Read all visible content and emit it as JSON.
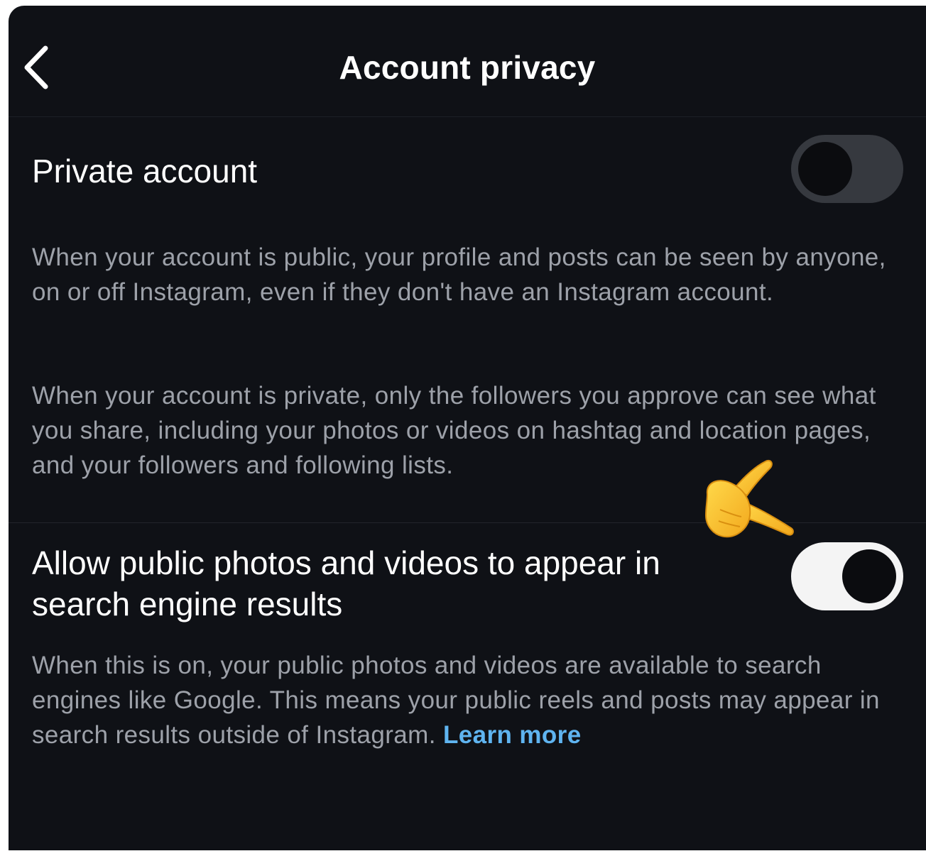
{
  "header": {
    "title": "Account privacy",
    "back_icon": "chevron-left-icon"
  },
  "private_account": {
    "label": "Private account",
    "toggle_on": false,
    "description_public": "When your account is public, your profile and posts can be seen by anyone, on or off Instagram, even if they don't have an Instagram account.",
    "description_private": "When your account is private, only the followers you approve can see what you share, including your photos or videos on hashtag and location pages, and your followers and following lists."
  },
  "search_engine": {
    "label": "Allow public photos and videos to appear in search engine results",
    "toggle_on": true,
    "description": "When this is on, your public photos and videos are available to search engines like Google. This means your public reels and posts may appear in search results outside of Instagram. ",
    "learn_more": "Learn more"
  },
  "decoration": {
    "pointing_hand_icon": "backhand-index-pointing-right-emoji"
  },
  "colors": {
    "background": "#0f1116",
    "text_primary": "#ffffff",
    "text_secondary": "#9da1a9",
    "link": "#5fb4f0",
    "toggle_off": "#36393f",
    "toggle_on": "#f4f4f4"
  }
}
